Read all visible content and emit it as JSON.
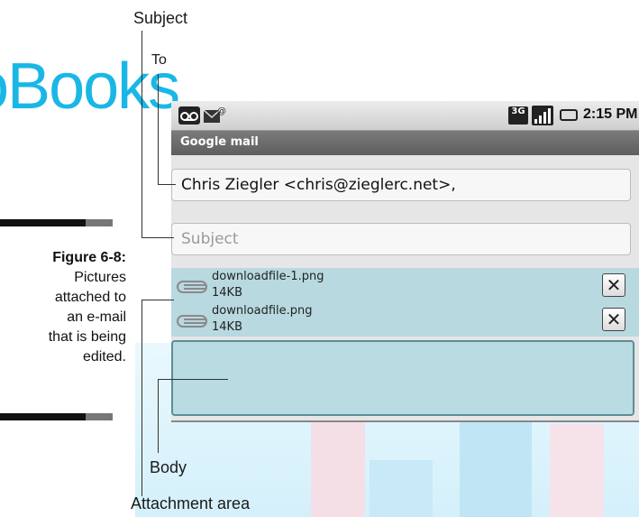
{
  "watermark": {
    "text": "oBooks"
  },
  "callouts": {
    "subject": "Subject",
    "to": "To",
    "body": "Body",
    "attachment_area": "Attachment area"
  },
  "caption": {
    "title": "Figure 6-8:",
    "lines": [
      "Pictures",
      "attached to",
      "an e-mail",
      "that is being",
      "edited."
    ]
  },
  "statusbar": {
    "time": "2:15 PM",
    "network": "3G",
    "icons": [
      "voicemail-icon",
      "new-mail-icon",
      "network-3g-icon",
      "signal-bars-icon",
      "battery-icon"
    ]
  },
  "app": {
    "title": "Google mail"
  },
  "compose": {
    "to_value": "Chris Ziegler <chris@zieglerc.net>,",
    "subject_placeholder": "Subject",
    "body_value": ""
  },
  "attachments": [
    {
      "name": "downloadfile-1.png",
      "size": "14KB"
    },
    {
      "name": "downloadfile.png",
      "size": "14KB"
    }
  ],
  "colors": {
    "watermark": "#19b7e6",
    "attachment_bg": "#b8d9e0",
    "title_bar": "#6a6a6a"
  }
}
